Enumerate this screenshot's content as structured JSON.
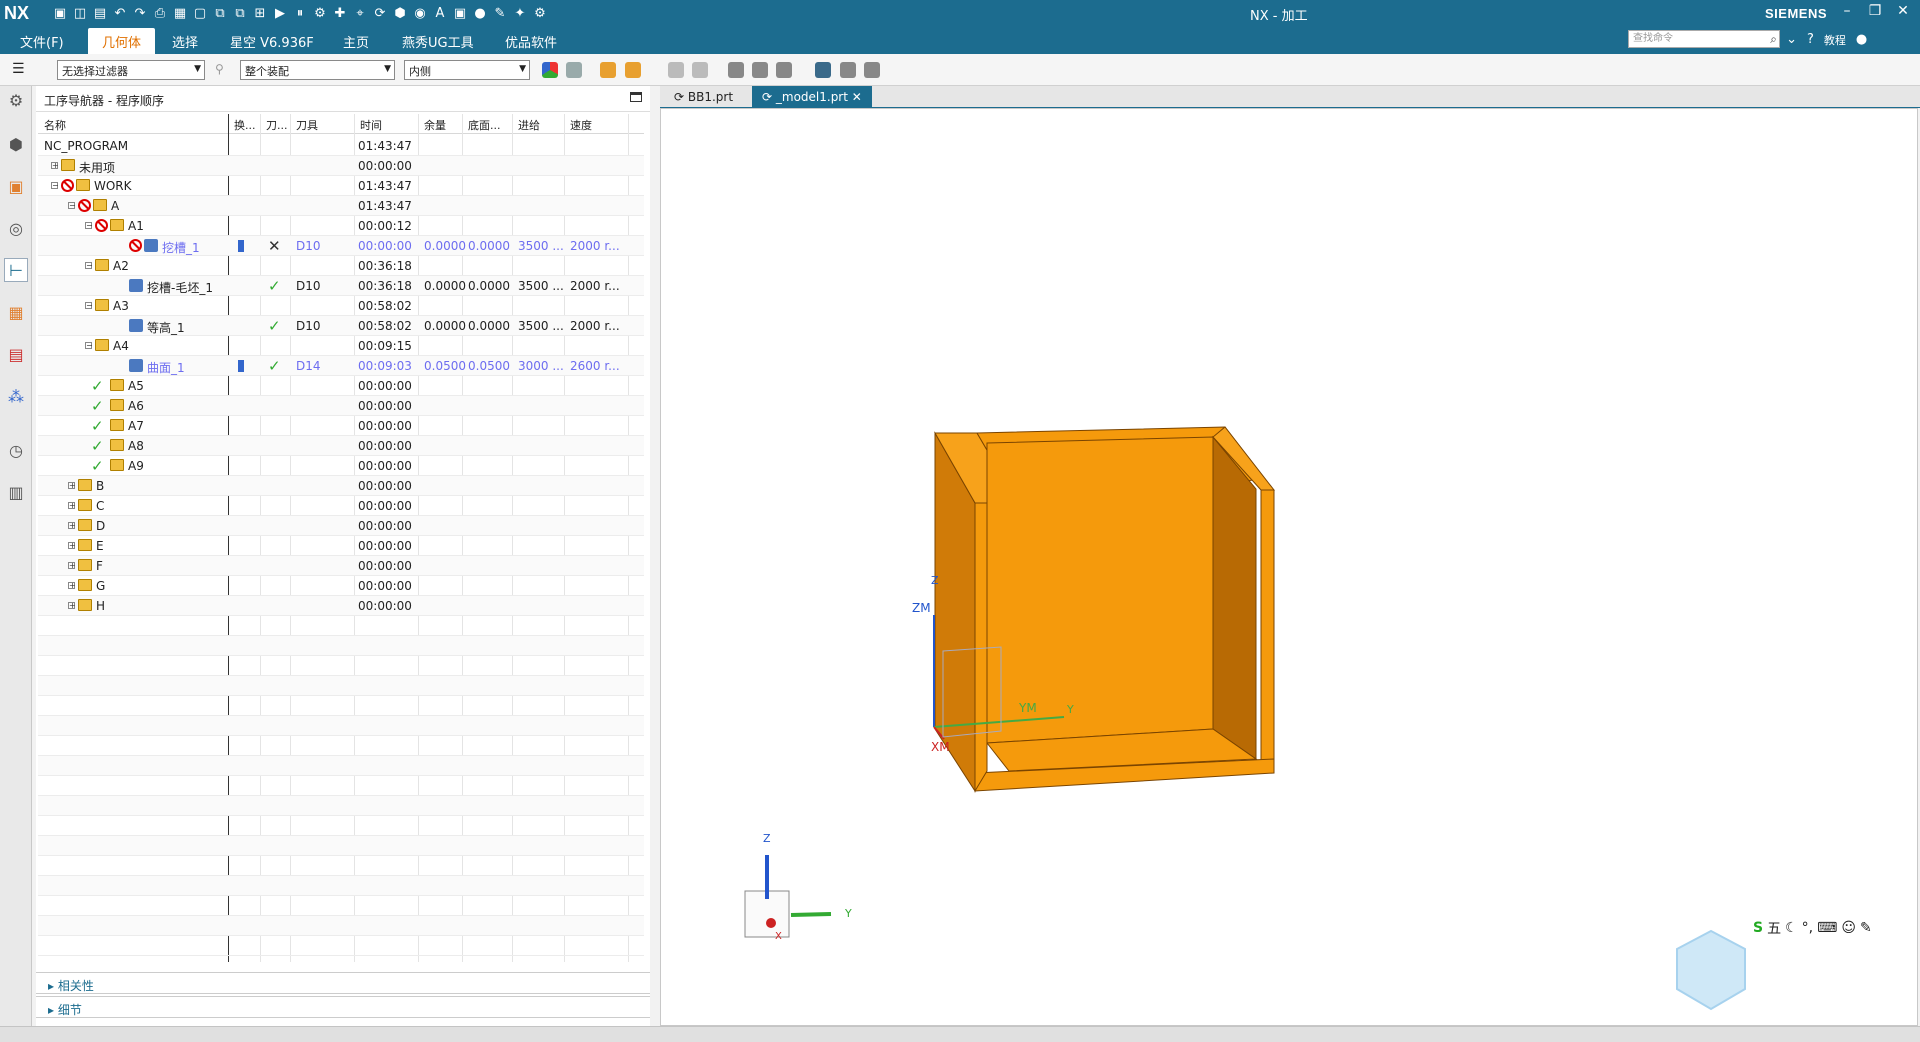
{
  "titlebar": {
    "logo": "NX",
    "title": "NX - 加工",
    "brand": "SIEMENS",
    "min": "–",
    "restore": "❐",
    "close": "✕"
  },
  "menubar": {
    "items": [
      "文件(F)",
      "几何体",
      "选择",
      "星空 V6.936F",
      "主页",
      "燕秀UG工具",
      "优品软件"
    ],
    "active_index": 1,
    "search_placeholder": "查找命令",
    "help_label": "教程"
  },
  "toolbar": {
    "filter_value": "无选择过滤器",
    "assembly_value": "整个装配",
    "scope_value": "内侧"
  },
  "navigator": {
    "title": "工序导航器 - 程序顺序",
    "columns": [
      "名称",
      "换...",
      "刀...",
      "刀具",
      "时间",
      "余量",
      "底面...",
      "进给",
      "速度"
    ],
    "rows": [
      {
        "name": "NC_PROGRAM",
        "time": "01:43:47",
        "tool": "",
        "stock": "",
        "floor": "",
        "feed": "",
        "speed": "",
        "blue": false
      },
      {
        "name": "未用项",
        "time": "00:00:00",
        "tool": "",
        "stock": "",
        "floor": "",
        "feed": "",
        "speed": "",
        "blue": false
      },
      {
        "name": "WORK",
        "time": "01:43:47",
        "tool": "",
        "stock": "",
        "floor": "",
        "feed": "",
        "speed": "",
        "blue": false
      },
      {
        "name": "A",
        "time": "01:43:47",
        "tool": "",
        "stock": "",
        "floor": "",
        "feed": "",
        "speed": "",
        "blue": false
      },
      {
        "name": "A1",
        "time": "00:00:12",
        "tool": "",
        "stock": "",
        "floor": "",
        "feed": "",
        "speed": "",
        "blue": false
      },
      {
        "name": "挖槽_1",
        "time": "00:00:00",
        "tool": "D10",
        "stock": "0.0000",
        "floor": "0.0000",
        "feed": "3500 ...",
        "speed": "2000 r...",
        "blue": true
      },
      {
        "name": "A2",
        "time": "00:36:18",
        "tool": "",
        "stock": "",
        "floor": "",
        "feed": "",
        "speed": "",
        "blue": false
      },
      {
        "name": "挖槽-毛坯_1",
        "time": "00:36:18",
        "tool": "D10",
        "stock": "0.0000",
        "floor": "0.0000",
        "feed": "3500 ...",
        "speed": "2000 r...",
        "blue": false
      },
      {
        "name": "A3",
        "time": "00:58:02",
        "tool": "",
        "stock": "",
        "floor": "",
        "feed": "",
        "speed": "",
        "blue": false
      },
      {
        "name": "等高_1",
        "time": "00:58:02",
        "tool": "D10",
        "stock": "0.0000",
        "floor": "0.0000",
        "feed": "3500 ...",
        "speed": "2000 r...",
        "blue": false
      },
      {
        "name": "A4",
        "time": "00:09:15",
        "tool": "",
        "stock": "",
        "floor": "",
        "feed": "",
        "speed": "",
        "blue": false
      },
      {
        "name": "曲面_1",
        "time": "00:09:03",
        "tool": "D14",
        "stock": "0.0500",
        "floor": "0.0500",
        "feed": "3000 ...",
        "speed": "2600 r...",
        "blue": true
      },
      {
        "name": "A5",
        "time": "00:00:00",
        "tool": "",
        "stock": "",
        "floor": "",
        "feed": "",
        "speed": "",
        "blue": false
      },
      {
        "name": "A6",
        "time": "00:00:00",
        "tool": "",
        "stock": "",
        "floor": "",
        "feed": "",
        "speed": "",
        "blue": false
      },
      {
        "name": "A7",
        "time": "00:00:00",
        "tool": "",
        "stock": "",
        "floor": "",
        "feed": "",
        "speed": "",
        "blue": false
      },
      {
        "name": "A8",
        "time": "00:00:00",
        "tool": "",
        "stock": "",
        "floor": "",
        "feed": "",
        "speed": "",
        "blue": false
      },
      {
        "name": "A9",
        "time": "00:00:00",
        "tool": "",
        "stock": "",
        "floor": "",
        "feed": "",
        "speed": "",
        "blue": false
      },
      {
        "name": "B",
        "time": "00:00:00",
        "tool": "",
        "stock": "",
        "floor": "",
        "feed": "",
        "speed": "",
        "blue": false
      },
      {
        "name": "C",
        "time": "00:00:00",
        "tool": "",
        "stock": "",
        "floor": "",
        "feed": "",
        "speed": "",
        "blue": false
      },
      {
        "name": "D",
        "time": "00:00:00",
        "tool": "",
        "stock": "",
        "floor": "",
        "feed": "",
        "speed": "",
        "blue": false
      },
      {
        "name": "E",
        "time": "00:00:00",
        "tool": "",
        "stock": "",
        "floor": "",
        "feed": "",
        "speed": "",
        "blue": false
      },
      {
        "name": "F",
        "time": "00:00:00",
        "tool": "",
        "stock": "",
        "floor": "",
        "feed": "",
        "speed": "",
        "blue": false
      },
      {
        "name": "G",
        "time": "00:00:00",
        "tool": "",
        "stock": "",
        "floor": "",
        "feed": "",
        "speed": "",
        "blue": false
      },
      {
        "name": "H",
        "time": "00:00:00",
        "tool": "",
        "stock": "",
        "floor": "",
        "feed": "",
        "speed": "",
        "blue": false
      }
    ],
    "panels": [
      "相关性",
      "细节"
    ]
  },
  "viewport": {
    "tabs": [
      "BB1.prt",
      "_model1.prt"
    ],
    "active_tab": 1,
    "axis_labels": {
      "zm": "ZM",
      "ym": "YM",
      "xm": "XM",
      "y": "Y",
      "z": "Z",
      "x": "X"
    },
    "part_color": "#f59a0c",
    "ime_label": "五"
  },
  "colors": {
    "accent": "#1c6c8f",
    "active_menu_text": "#e07000",
    "blue_text": "#6d6df0",
    "check": "#33aa33",
    "prohibit": "#dd0000"
  }
}
